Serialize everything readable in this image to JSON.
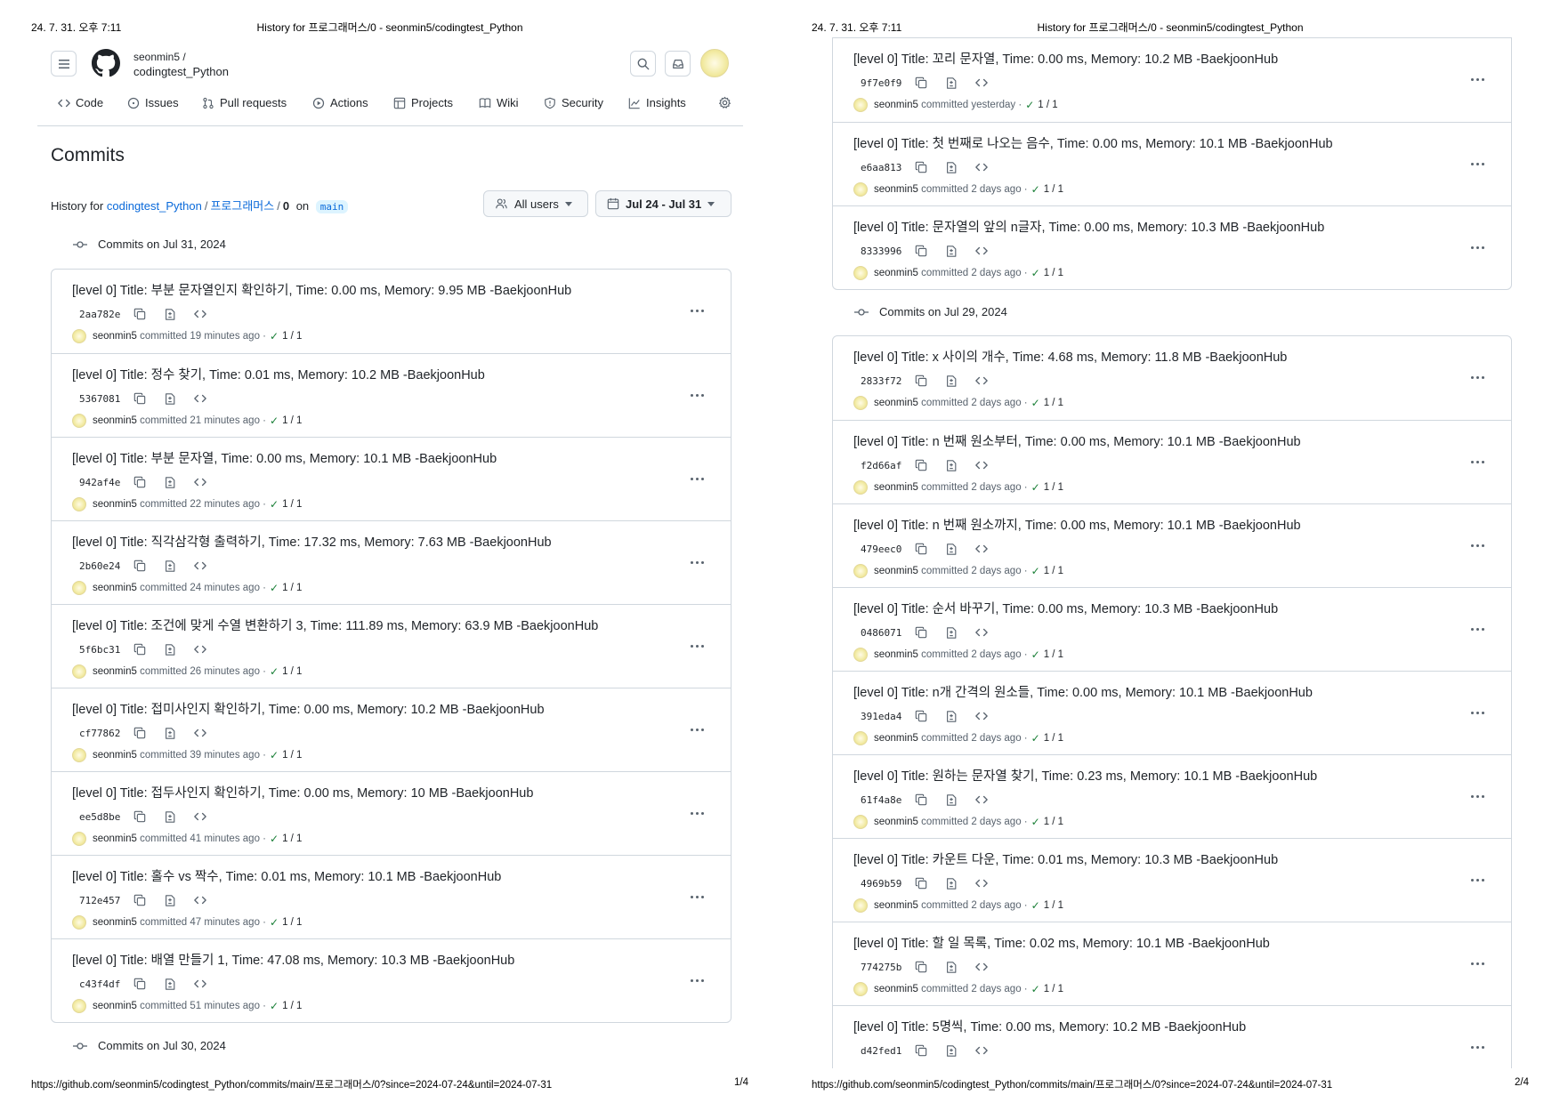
{
  "print": {
    "datetime": "24. 7. 31. 오후 7:11",
    "doc_title": "History for 프로그래머스/0 - seonmin5/codingtest_Python",
    "url": "https://github.com/seonmin5/codingtest_Python/commits/main/프로그래머스/0?since=2024-07-24&until=2024-07-31",
    "page1_number": "1/4",
    "page2_number": "2/4"
  },
  "repo": {
    "owner": "seonmin5 /",
    "name": "codingtest_Python"
  },
  "nav": {
    "tabs": [
      {
        "label": "Code",
        "icon": "code-icon"
      },
      {
        "label": "Issues",
        "icon": "issue-icon"
      },
      {
        "label": "Pull requests",
        "icon": "pull-request-icon"
      },
      {
        "label": "Actions",
        "icon": "play-icon"
      },
      {
        "label": "Projects",
        "icon": "table-icon"
      },
      {
        "label": "Wiki",
        "icon": "book-icon"
      },
      {
        "label": "Security",
        "icon": "shield-icon"
      },
      {
        "label": "Insights",
        "icon": "graph-icon"
      }
    ]
  },
  "page": {
    "title": "Commits",
    "history_prefix": "History for",
    "path_repo": "codingtest_Python",
    "path_sep": "/",
    "path_dir": "프로그래머스",
    "path_leaf": "0",
    "on_label": "on",
    "branch": "main",
    "users_filter": "All users",
    "date_filter": "Jul 24 - Jul 31"
  },
  "page1": {
    "group_jul31": {
      "heading": "Commits on Jul 31, 2024",
      "commits": [
        {
          "title": "[level 0] Title: 부분 문자열인지 확인하기, Time: 0.00 ms, Memory: 9.95 MB -BaekjoonHub",
          "sha": "2aa782e",
          "author": "seonmin5",
          "verb": "committed",
          "time": "19 minutes ago",
          "checks": "1 / 1"
        },
        {
          "title": "[level 0] Title: 정수 찾기, Time: 0.01 ms, Memory: 10.2 MB -BaekjoonHub",
          "sha": "5367081",
          "author": "seonmin5",
          "verb": "committed",
          "time": "21 minutes ago",
          "checks": "1 / 1"
        },
        {
          "title": "[level 0] Title: 부분 문자열, Time: 0.00 ms, Memory: 10.1 MB -BaekjoonHub",
          "sha": "942af4e",
          "author": "seonmin5",
          "verb": "committed",
          "time": "22 minutes ago",
          "checks": "1 / 1"
        },
        {
          "title": "[level 0] Title: 직각삼각형 출력하기, Time: 17.32 ms, Memory: 7.63 MB -BaekjoonHub",
          "sha": "2b60e24",
          "author": "seonmin5",
          "verb": "committed",
          "time": "24 minutes ago",
          "checks": "1 / 1"
        },
        {
          "title": "[level 0] Title: 조건에 맞게 수열 변환하기 3, Time: 111.89 ms, Memory: 63.9 MB -BaekjoonHub",
          "sha": "5f6bc31",
          "author": "seonmin5",
          "verb": "committed",
          "time": "26 minutes ago",
          "checks": "1 / 1"
        },
        {
          "title": "[level 0] Title: 접미사인지 확인하기, Time: 0.00 ms, Memory: 10.2 MB -BaekjoonHub",
          "sha": "cf77862",
          "author": "seonmin5",
          "verb": "committed",
          "time": "39 minutes ago",
          "checks": "1 / 1"
        },
        {
          "title": "[level 0] Title: 접두사인지 확인하기, Time: 0.00 ms, Memory: 10 MB -BaekjoonHub",
          "sha": "ee5d8be",
          "author": "seonmin5",
          "verb": "committed",
          "time": "41 minutes ago",
          "checks": "1 / 1"
        },
        {
          "title": "[level 0] Title: 홀수 vs 짝수, Time: 0.01 ms, Memory: 10.1 MB -BaekjoonHub",
          "sha": "712e457",
          "author": "seonmin5",
          "verb": "committed",
          "time": "47 minutes ago",
          "checks": "1 / 1"
        },
        {
          "title": "[level 0] Title: 배열 만들기 1, Time: 47.08 ms, Memory: 10.3 MB -BaekjoonHub",
          "sha": "c43f4df",
          "author": "seonmin5",
          "verb": "committed",
          "time": "51 minutes ago",
          "checks": "1 / 1"
        }
      ]
    },
    "group_jul30_heading": "Commits on Jul 30, 2024"
  },
  "page2": {
    "group_jul30_cont": {
      "commits": [
        {
          "title": "[level 0] Title: 꼬리 문자열, Time: 0.00 ms, Memory: 10.2 MB -BaekjoonHub",
          "sha": "9f7e0f9",
          "author": "seonmin5",
          "verb": "committed",
          "time": "yesterday",
          "checks": "1 / 1"
        },
        {
          "title": "[level 0] Title: 첫 번째로 나오는 음수, Time: 0.00 ms, Memory: 10.1 MB -BaekjoonHub",
          "sha": "e6aa813",
          "author": "seonmin5",
          "verb": "committed",
          "time": "2 days ago",
          "checks": "1 / 1"
        },
        {
          "title": "[level 0] Title: 문자열의 앞의 n글자, Time: 0.00 ms, Memory: 10.3 MB -BaekjoonHub",
          "sha": "8333996",
          "author": "seonmin5",
          "verb": "committed",
          "time": "2 days ago",
          "checks": "1 / 1"
        }
      ]
    },
    "group_jul29": {
      "heading": "Commits on Jul 29, 2024",
      "commits": [
        {
          "title": "[level 0] Title: x 사이의 개수, Time: 4.68 ms, Memory: 11.8 MB -BaekjoonHub",
          "sha": "2833f72",
          "author": "seonmin5",
          "verb": "committed",
          "time": "2 days ago",
          "checks": "1 / 1"
        },
        {
          "title": "[level 0] Title: n 번째 원소부터, Time: 0.00 ms, Memory: 10.1 MB -BaekjoonHub",
          "sha": "f2d66af",
          "author": "seonmin5",
          "verb": "committed",
          "time": "2 days ago",
          "checks": "1 / 1"
        },
        {
          "title": "[level 0] Title: n 번째 원소까지, Time: 0.00 ms, Memory: 10.1 MB -BaekjoonHub",
          "sha": "479eec0",
          "author": "seonmin5",
          "verb": "committed",
          "time": "2 days ago",
          "checks": "1 / 1"
        },
        {
          "title": "[level 0] Title: 순서 바꾸기, Time: 0.00 ms, Memory: 10.3 MB -BaekjoonHub",
          "sha": "0486071",
          "author": "seonmin5",
          "verb": "committed",
          "time": "2 days ago",
          "checks": "1 / 1"
        },
        {
          "title": "[level 0] Title: n개 간격의 원소들, Time: 0.00 ms, Memory: 10.1 MB -BaekjoonHub",
          "sha": "391eda4",
          "author": "seonmin5",
          "verb": "committed",
          "time": "2 days ago",
          "checks": "1 / 1"
        },
        {
          "title": "[level 0] Title: 원하는 문자열 찾기, Time: 0.23 ms, Memory: 10.1 MB -BaekjoonHub",
          "sha": "61f4a8e",
          "author": "seonmin5",
          "verb": "committed",
          "time": "2 days ago",
          "checks": "1 / 1"
        },
        {
          "title": "[level 0] Title: 카운트 다운, Time: 0.01 ms, Memory: 10.3 MB -BaekjoonHub",
          "sha": "4969b59",
          "author": "seonmin5",
          "verb": "committed",
          "time": "2 days ago",
          "checks": "1 / 1"
        },
        {
          "title": "[level 0] Title: 할 일 목록, Time: 0.02 ms, Memory: 10.1 MB -BaekjoonHub",
          "sha": "774275b",
          "author": "seonmin5",
          "verb": "committed",
          "time": "2 days ago",
          "checks": "1 / 1"
        },
        {
          "title": "[level 0] Title: 5명씩, Time: 0.00 ms, Memory: 10.2 MB -BaekjoonHub",
          "sha": "d42fed1",
          "author": "",
          "verb": "",
          "time": "",
          "checks": ""
        }
      ]
    }
  }
}
